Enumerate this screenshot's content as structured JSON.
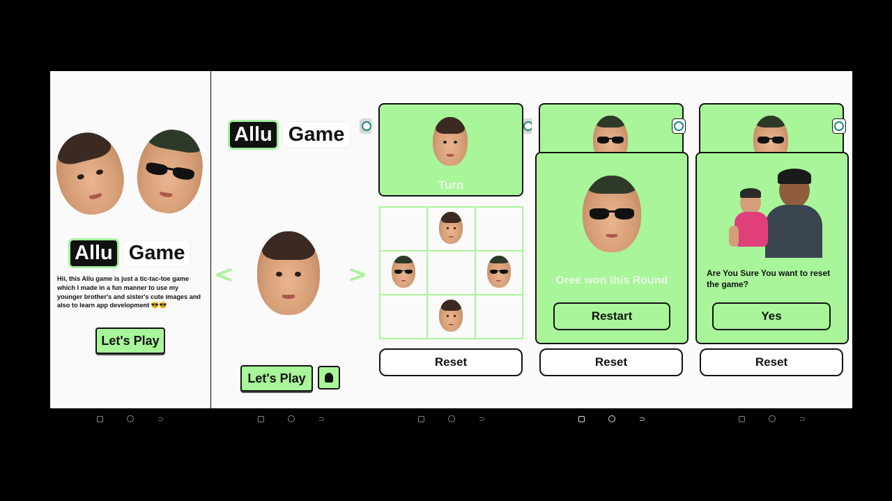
{
  "screen1": {
    "logo_left": "Allu",
    "logo_right": "Game",
    "intro_text": "Hii, this Allu game is just a tic-tac-toe game which I made in a fun manner to use my younger brother's and sister's cute images and also to learn app development 😎😎",
    "play_button": "Let's Play"
  },
  "screen2": {
    "logo_left": "Allu",
    "logo_right": "Game",
    "prev_arrow": "<",
    "next_arrow": ">",
    "play_button": "Let's Play",
    "incognito_icon": "spy-icon"
  },
  "screen3": {
    "turn_label": "Turn",
    "reset_button": "Reset"
  },
  "screen4": {
    "win_message": "Oree won this Round",
    "restart_button": "Restart",
    "reset_button": "Reset"
  },
  "screen5": {
    "confirm_message": "Are You Sure You want to reset the game?",
    "yes_button": "Yes",
    "reset_button": "Reset"
  },
  "colors": {
    "accent": "#a8f59a",
    "background": "#fafafa",
    "frame": "#000000"
  },
  "navbar": [
    "recent-apps-icon",
    "home-icon",
    "back-icon"
  ]
}
